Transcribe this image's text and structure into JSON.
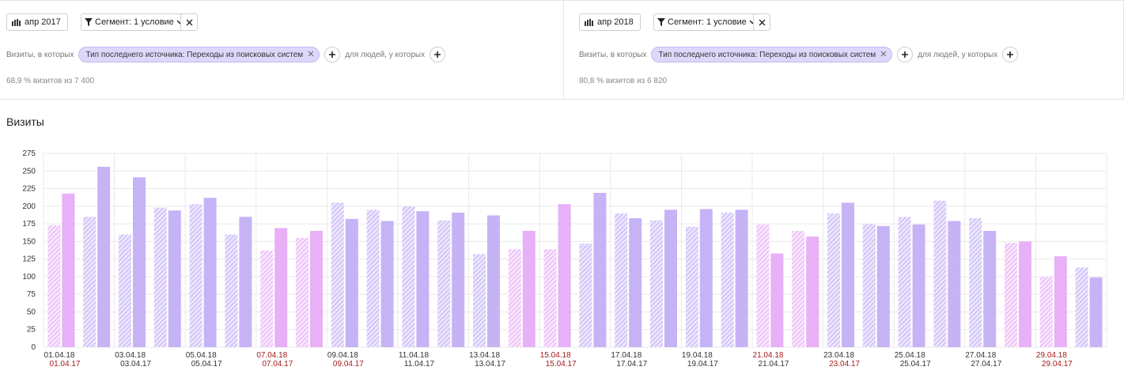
{
  "segments": [
    {
      "period_label": "апр 2017",
      "segment_label": "Сегмент: 1 условие",
      "visits_prefix": "Визиты, в которых",
      "condition": "Тип последнего источника: Переходы из поисковых систем",
      "people_label": "для людей, у которых",
      "stat": "68,9 % визитов из 7 400"
    },
    {
      "period_label": "апр 2018",
      "segment_label": "Сегмент: 1 условие",
      "visits_prefix": "Визиты, в которых",
      "condition": "Тип последнего источника: Переходы из поисковых систем",
      "people_label": "для людей, у которых",
      "stat": "80,8 % визитов из 6 820"
    }
  ],
  "chart_title": "Визиты",
  "colors": {
    "violet": "#c5b3f6",
    "pink": "#e8b0f6",
    "weekend_tick": "#a31b1b",
    "grid": "#e9e9e9",
    "chip_bg": "#ddd8fb"
  },
  "chart_data": {
    "type": "bar",
    "y_ticks": [
      0,
      25,
      50,
      75,
      100,
      125,
      150,
      175,
      200,
      225,
      250,
      275
    ],
    "ylim": [
      0,
      275
    ],
    "grid": true,
    "categories": [
      "01.04",
      "02.04",
      "03.04",
      "04.04",
      "05.04",
      "06.04",
      "07.04",
      "08.04",
      "09.04",
      "10.04",
      "11.04",
      "12.04",
      "13.04",
      "14.04",
      "15.04",
      "16.04",
      "17.04",
      "18.04",
      "19.04",
      "20.04",
      "21.04",
      "22.04",
      "23.04",
      "24.04",
      "25.04",
      "26.04",
      "27.04",
      "28.04",
      "29.04",
      "30.04"
    ],
    "weekend": [
      true,
      false,
      false,
      false,
      false,
      false,
      true,
      true,
      false,
      false,
      false,
      false,
      false,
      true,
      true,
      false,
      false,
      false,
      false,
      false,
      true,
      true,
      false,
      false,
      false,
      false,
      false,
      true,
      true,
      false
    ],
    "series": [
      {
        "values": [
          173,
          185,
          160,
          198,
          203,
          160,
          137,
          155,
          205,
          195,
          200,
          180,
          132,
          139,
          139,
          147,
          190,
          180,
          171,
          191,
          174,
          165,
          190,
          175,
          185,
          208,
          183,
          148,
          100,
          113
        ]
      },
      {
        "values": [
          218,
          256,
          241,
          194,
          212,
          185,
          169,
          165,
          182,
          179,
          193,
          191,
          187,
          165,
          203,
          219,
          183,
          195,
          196,
          195,
          133,
          157,
          205,
          172,
          174,
          179,
          165,
          150,
          129,
          99
        ]
      }
    ],
    "x_tick_labels_2018": [
      "01.04.18",
      "03.04.18",
      "05.04.18",
      "07.04.18",
      "09.04.18",
      "11.04.18",
      "13.04.18",
      "15.04.18",
      "17.04.18",
      "19.04.18",
      "21.04.18",
      "23.04.18",
      "25.04.18",
      "27.04.18",
      "29.04.18"
    ],
    "x_tick_labels_2017": [
      "01.04.17",
      "03.04.17",
      "05.04.17",
      "07.04.17",
      "09.04.17",
      "11.04.17",
      "13.04.17",
      "15.04.17",
      "17.04.17",
      "19.04.17",
      "21.04.17",
      "23.04.17",
      "25.04.17",
      "27.04.17",
      "29.04.17"
    ],
    "x_tick_weekend_2018": [
      false,
      false,
      false,
      true,
      false,
      false,
      false,
      true,
      false,
      false,
      true,
      false,
      false,
      false,
      true
    ],
    "x_tick_weekend_2017": [
      true,
      false,
      false,
      true,
      true,
      false,
      false,
      true,
      false,
      false,
      false,
      true,
      false,
      false,
      true
    ]
  }
}
